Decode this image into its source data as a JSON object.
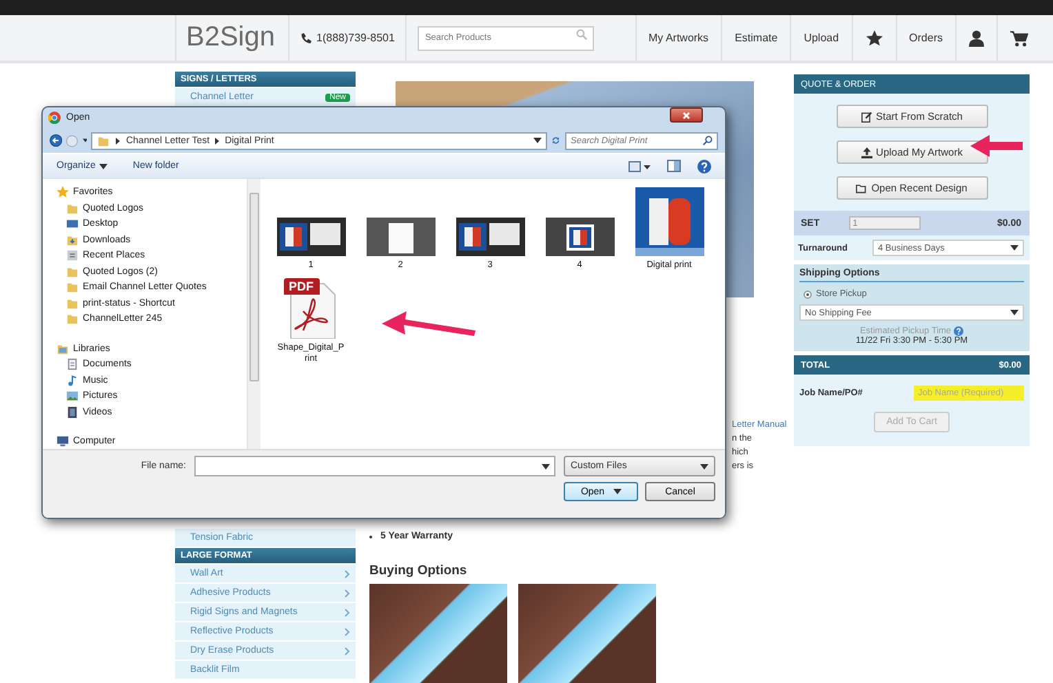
{
  "header": {
    "logo": "B2Sign",
    "phone": "1(888)739-8501",
    "search": {
      "placeholder": "Search Products"
    },
    "nav": [
      {
        "kind": "link",
        "label": "My Artworks"
      },
      {
        "kind": "link",
        "label": "Estimate"
      },
      {
        "kind": "link",
        "label": "Upload"
      },
      {
        "kind": "star"
      },
      {
        "kind": "link",
        "label": "Orders"
      },
      {
        "kind": "account"
      },
      {
        "kind": "cart"
      }
    ]
  },
  "sidebar": {
    "sections": [
      {
        "title": "SIGNS / LETTERS",
        "items": [
          {
            "label": "Channel Letter",
            "badge": "New",
            "submenu": false
          }
        ]
      },
      {
        "items": [
          {
            "label": "Tension Fabric",
            "submenu": false
          }
        ]
      },
      {
        "title": "LARGE FORMAT",
        "items": [
          {
            "label": "Wall Art",
            "submenu": true
          },
          {
            "label": "Adhesive Products",
            "submenu": true
          },
          {
            "label": "Rigid Signs and Magnets",
            "submenu": true
          },
          {
            "label": "Reflective Products",
            "submenu": true
          },
          {
            "label": "Dry Erase Products",
            "submenu": true
          },
          {
            "label": "Backlit Film",
            "submenu": false
          }
        ]
      }
    ]
  },
  "main": {
    "fragments": [
      {
        "kind": "link",
        "text": "Letter Manual"
      },
      {
        "kind": "text",
        "text": "n the"
      },
      {
        "kind": "text",
        "text": "hich"
      },
      {
        "kind": "text",
        "text": "ers is"
      }
    ],
    "bullets": [
      "5 Year Warranty"
    ],
    "buying_options": {
      "title": "Buying Options"
    }
  },
  "quote_order": {
    "title": "QUOTE & ORDER",
    "buttons": [
      {
        "kind": "edit",
        "label": "Start From Scratch"
      },
      {
        "kind": "upload",
        "label": "Upload My Artwork"
      },
      {
        "kind": "folder",
        "label": "Open Recent Design"
      }
    ],
    "set": {
      "label": "SET",
      "value": "1",
      "price": "$0.00"
    },
    "turnaround": {
      "label": "Turnaround",
      "value": "4 Business Days"
    },
    "shipping": {
      "title": "Shipping Options",
      "option": {
        "label": "Store Pickup",
        "selected": true
      },
      "method": "No Shipping Fee",
      "estimate_label": "Estimated Pickup Time",
      "estimate": "11/22 Fri 3:30 PM - 5:30 PM"
    },
    "total": {
      "label": "TOTAL",
      "price": "$0.00"
    },
    "job_name": {
      "label": "Job Name/PO#",
      "placeholder": "Job Name (Required)"
    },
    "add_to_cart": {
      "label": "Add To Cart",
      "disabled": true
    }
  },
  "dialog": {
    "title": "Open",
    "path": [
      "Channel Letter Test",
      "Digital Print"
    ],
    "search": {
      "placeholder": "Search Digital Print"
    },
    "toolbar": [
      {
        "kind": "menu",
        "label": "Organize"
      },
      {
        "kind": "button",
        "label": "New folder"
      }
    ],
    "navigation": [
      {
        "kind": "favorites",
        "label": "Favorites",
        "children": [
          {
            "kind": "folder",
            "label": "Quoted Logos"
          },
          {
            "kind": "desktop",
            "label": "Desktop"
          },
          {
            "kind": "downloads",
            "label": "Downloads"
          },
          {
            "kind": "recent",
            "label": "Recent Places"
          },
          {
            "kind": "folder",
            "label": "Quoted Logos (2)"
          },
          {
            "kind": "folder",
            "label": "Email Channel Letter Quotes"
          },
          {
            "kind": "folder",
            "label": "print-status - Shortcut"
          },
          {
            "kind": "folder",
            "label": "ChannelLetter 245"
          }
        ]
      },
      {
        "kind": "libraries",
        "label": "Libraries",
        "children": [
          {
            "kind": "documents",
            "label": "Documents"
          },
          {
            "kind": "music",
            "label": "Music"
          },
          {
            "kind": "pictures",
            "label": "Pictures"
          },
          {
            "kind": "videos",
            "label": "Videos"
          }
        ]
      },
      {
        "kind": "computer",
        "label": "Computer"
      }
    ],
    "files": [
      {
        "kind": "screen-window",
        "label": "1"
      },
      {
        "kind": "screen-page",
        "label": "2"
      },
      {
        "kind": "screen-window",
        "label": "3"
      },
      {
        "kind": "screen-logo",
        "label": "4"
      },
      {
        "kind": "image",
        "label": "Digital print"
      },
      {
        "kind": "pdf",
        "label": "Shape_Digital_Print",
        "badge": "PDF"
      }
    ],
    "file_name": {
      "label": "File name:"
    },
    "file_type": "Custom Files",
    "buttons": [
      {
        "kind": "split",
        "label": "Open"
      },
      {
        "kind": "plain",
        "label": "Cancel"
      }
    ]
  }
}
